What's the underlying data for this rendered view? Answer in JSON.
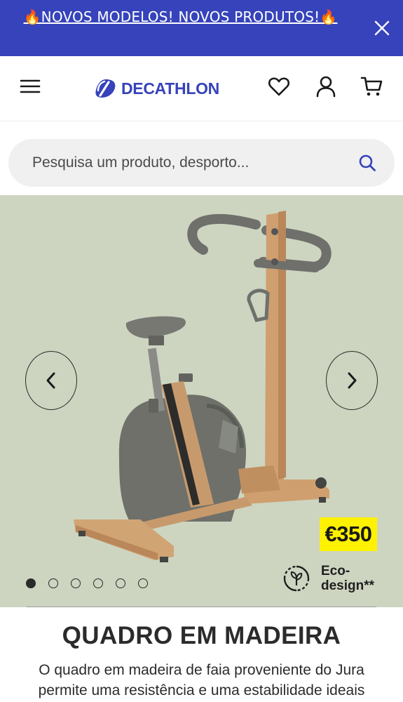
{
  "promo": {
    "text": "🔥NOVOS MODELOS! NOVOS PRODUTOS!🔥",
    "close_icon": "close-icon",
    "background": "#3643ba"
  },
  "header": {
    "brand": "DECATHLON",
    "brand_color": "#3643ba",
    "icons": [
      "menu-icon",
      "heart-icon",
      "user-icon",
      "cart-icon"
    ]
  },
  "search": {
    "placeholder": "Pesquisa um produto, desporto...",
    "value": "",
    "icon": "search-icon"
  },
  "hero": {
    "background": "#cdd5c1",
    "image_alt": "Domyos Woodbike exercise bike with wooden frame",
    "price": "€350",
    "price_badge_color": "#fff200",
    "eco_label_line1": "Eco-",
    "eco_label_line2": "design**",
    "carousel": {
      "total_slides": 6,
      "active_index": 0
    },
    "prev_icon": "chevron-left-icon",
    "next_icon": "chevron-right-icon"
  },
  "section": {
    "title": "QUADRO EM MADEIRA",
    "body": "O quadro em madeira de faia proveniente do Jura permite uma resistência e uma estabilidade ideais"
  }
}
